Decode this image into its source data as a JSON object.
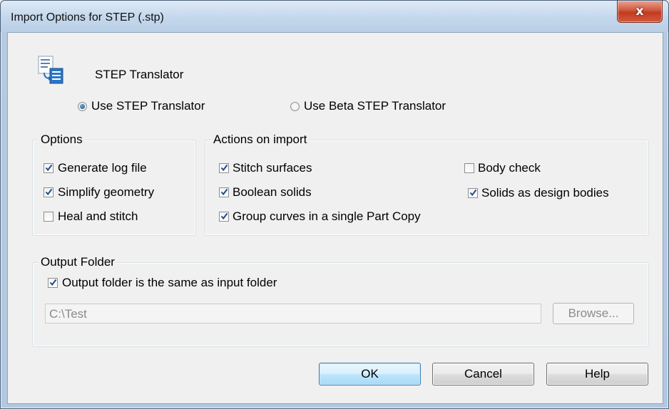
{
  "window": {
    "title": "Import Options for STEP (.stp)",
    "close_glyph": "x"
  },
  "header": {
    "icon": "step-translator-icon",
    "label": "STEP Translator"
  },
  "translator_choice": {
    "options": [
      {
        "label": "Use STEP Translator",
        "selected": true
      },
      {
        "label": "Use Beta STEP Translator",
        "selected": false
      }
    ]
  },
  "options_group": {
    "title": "Options",
    "items": [
      {
        "label": "Generate log file",
        "checked": true
      },
      {
        "label": "Simplify geometry",
        "checked": true
      },
      {
        "label": "Heal and stitch",
        "checked": false
      }
    ]
  },
  "actions_group": {
    "title": "Actions on import",
    "items": [
      {
        "label": "Stitch surfaces",
        "checked": true
      },
      {
        "label": "Boolean solids",
        "checked": true
      },
      {
        "label": "Group curves in a single Part Copy",
        "checked": true
      },
      {
        "label": "Body check",
        "checked": false
      },
      {
        "label": "Solids as design bodies",
        "checked": true
      }
    ]
  },
  "output_group": {
    "title": "Output Folder",
    "same_as_input": {
      "label": "Output folder is the same as input folder",
      "checked": true
    },
    "path_value": "C:\\Test",
    "browse_label": "Browse..."
  },
  "buttons": {
    "ok": "OK",
    "cancel": "Cancel",
    "help": "Help"
  },
  "colors": {
    "accent": "#3c7fb1",
    "checkmark": "#1d4e8f",
    "close_button": "#c23b20"
  }
}
